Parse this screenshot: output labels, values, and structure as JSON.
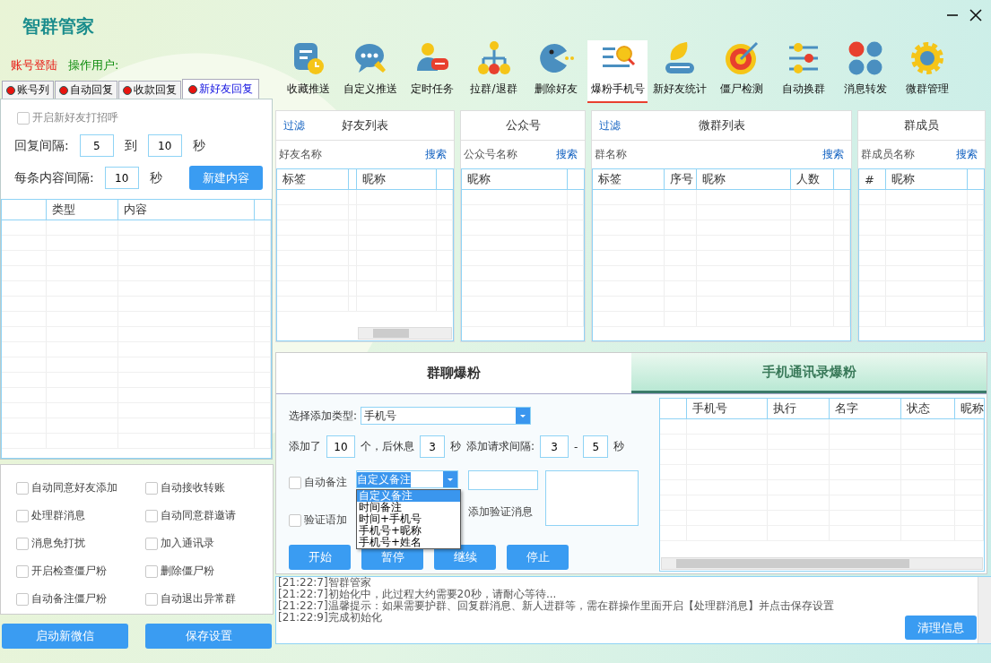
{
  "app": {
    "title": "智群管家",
    "login": "账号登陆",
    "operator": "操作用户:"
  },
  "left_tabs": [
    {
      "label": "账号列",
      "selected": false
    },
    {
      "label": "自动回复",
      "selected": false
    },
    {
      "label": "收款回复",
      "selected": false
    },
    {
      "label": "新好友回复",
      "selected": true
    }
  ],
  "greeting": {
    "label": "开启新好友打招呼",
    "checked": false,
    "disabled": true
  },
  "reply_interval": {
    "label": "回复间隔:",
    "from": "5",
    "to_label": "到",
    "to": "10",
    "unit": "秒"
  },
  "content_interval": {
    "label": "每条内容间隔:",
    "value": "10",
    "unit": "秒",
    "button": "新建内容"
  },
  "content_table": {
    "columns": [
      "类型",
      "内容"
    ]
  },
  "options": [
    {
      "label": "自动同意好友添加",
      "checked": false
    },
    {
      "label": "自动接收转账",
      "checked": false
    },
    {
      "label": "处理群消息",
      "checked": false
    },
    {
      "label": "自动同意群邀请",
      "checked": false
    },
    {
      "label": "消息免打扰",
      "checked": false
    },
    {
      "label": "加入通讯录",
      "checked": false
    },
    {
      "label": "开启检查僵尸粉",
      "checked": false
    },
    {
      "label": "删除僵尸粉",
      "checked": false
    },
    {
      "label": "自动备注僵尸粉",
      "checked": false
    },
    {
      "label": "自动退出异常群",
      "checked": false
    }
  ],
  "left_buttons": [
    "启动新微信",
    "保存设置"
  ],
  "toolbar": [
    {
      "label": "收藏推送",
      "selected": false
    },
    {
      "label": "自定义推送",
      "selected": false
    },
    {
      "label": "定时任务",
      "selected": false
    },
    {
      "label": "拉群/退群",
      "selected": false
    },
    {
      "label": "删除好友",
      "selected": false
    },
    {
      "label": "爆粉手机号",
      "selected": true
    },
    {
      "label": "新好友统计",
      "selected": false
    },
    {
      "label": "僵尸检测",
      "selected": false
    },
    {
      "label": "自动换群",
      "selected": false
    },
    {
      "label": "消息转发",
      "selected": false
    },
    {
      "label": "微群管理",
      "selected": false
    }
  ],
  "panels": [
    {
      "filter": "过滤",
      "title": "好友列表",
      "search_label": "好友名称",
      "search": "搜索",
      "columns": [
        "标签",
        "昵称"
      ]
    },
    {
      "title": "公众号",
      "search_label": "公众号名称",
      "search": "搜索",
      "columns": [
        "昵称"
      ]
    },
    {
      "filter": "过滤",
      "title": "微群列表",
      "search_label": "群名称",
      "search": "搜索",
      "columns": [
        "标签",
        "序号",
        "昵称",
        "人数"
      ]
    },
    {
      "title": "群成员",
      "search_label": "群成员名称",
      "search": "搜索",
      "columns": [
        "#",
        "昵称"
      ]
    }
  ],
  "bottom_tabs": [
    {
      "label": "群聊爆粉",
      "selected": true
    },
    {
      "label": "手机通讯录爆粉",
      "selected": false
    }
  ],
  "form": {
    "type_label": "选择添加类型:",
    "type_value": "手机号",
    "added": "添加了",
    "added_value": "10",
    "rest": "个，后休息",
    "rest_value": "3",
    "sec": "秒",
    "interval": "添加请求间隔:",
    "interval_from": "3",
    "dash": "-",
    "interval_to": "5",
    "sec2": "秒",
    "auto_note": {
      "label": "自动备注",
      "checked": false
    },
    "note_value": "自定义备注",
    "note_options": [
      {
        "label": "自定义备注",
        "selected": true
      },
      {
        "label": "时间备注",
        "selected": false
      },
      {
        "label": "时间+手机号",
        "selected": false
      },
      {
        "label": "手机号+昵称",
        "selected": false
      },
      {
        "label": "手机号+姓名",
        "selected": false
      }
    ],
    "verify": {
      "label": "验证语加",
      "checked": false
    },
    "verify_msg": "添加验证消息",
    "buttons": [
      "开始",
      "暂停",
      "继续",
      "停止"
    ]
  },
  "phone_table": {
    "columns": [
      "手机号",
      "执行",
      "名字",
      "状态",
      "昵称"
    ]
  },
  "log": {
    "lines": [
      "[21:22:7]智群管家",
      "[21:22:7]初始化中，此过程大约需要20秒，请耐心等待...",
      "[21:22:7]温馨提示：如果需要护群、回复群消息、新人进群等，需在群操作里面开启【处理群消息】并点击保存设置",
      "[21:22:9]完成初始化"
    ],
    "button": "清理信息"
  }
}
